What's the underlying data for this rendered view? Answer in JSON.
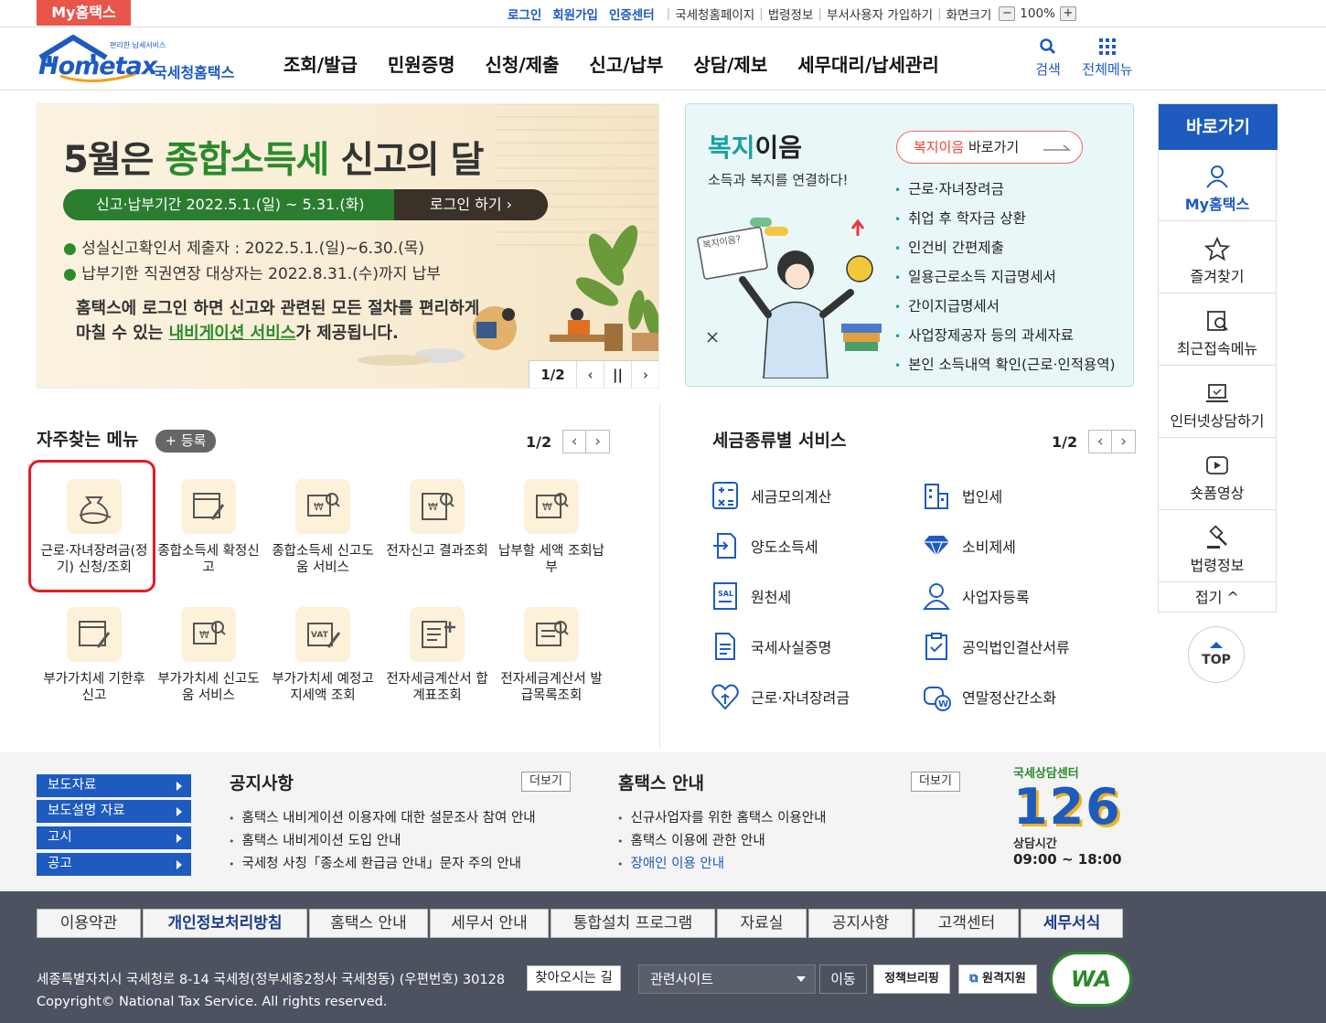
{
  "util": {
    "my_hometax": "My홈택스",
    "login": "로그인",
    "join": "회원가입",
    "cert": "인증센터",
    "nts_home": "국세청홈페이지",
    "law": "법령정보",
    "dept_join": "부서사용자 가입하기",
    "screen_size": "화면크기",
    "zoom_minus": "−",
    "zoom": "100%",
    "zoom_plus": "+"
  },
  "header": {
    "logo_top": "편리한 납세서비스",
    "logo_main": "Hometax",
    "logo_sub": "국세청홈택스",
    "gnb": [
      "조회/발급",
      "민원증명",
      "신청/제출",
      "신고/납부",
      "상담/제보",
      "세무대리/납세관리"
    ],
    "search": "검색",
    "all_menu": "전체메뉴"
  },
  "banner": {
    "title_a": "5월은 ",
    "title_b": "종합소득세",
    "title_c": " 신고의 달",
    "period": "신고·납부기간  2022.5.1.(일) ~ 5.31.(화)",
    "login_btn": "로그인 하기  ›",
    "bullet1": "성실신고확인서 제출자 : 2022.5.1.(일)~6.30.(목)",
    "bullet2": "납부기한 직권연장 대상자는 2022.8.31.(수)까지 납부",
    "desc1": "홈택스에 로그인 하면 신고와 관련된 모든 절차를 편리하게",
    "desc2a": "마칠 수 있는 ",
    "desc2b": "내비게이션 서비스",
    "desc2c": "가 제공됩니다.",
    "page": "1/2",
    "prev": "‹",
    "pause": "||",
    "next": "›"
  },
  "welfare": {
    "title_a": "복지",
    "title_b": "이음",
    "sub": "소득과 복지를 연결하다!",
    "go_a": "복지이음",
    "go_b": " 바로가기",
    "bubble": "복지이음?",
    "items": [
      "근로·자녀장려금",
      "취업 후 학자금 상환",
      "인건비 간편제출",
      "일용근로소득 지급명세서",
      "간이지급명세서",
      "사업장제공자 등의 과세자료",
      "본인 소득내역 확인(근로·인적용역)"
    ]
  },
  "quick": {
    "head": "바로가기",
    "items": [
      "My홈택스",
      "즐겨찾기",
      "최근접속메뉴",
      "인터넷상담하기",
      "숏폼영상",
      "법령정보"
    ],
    "fold": "접기 ^",
    "top": "TOP"
  },
  "freq": {
    "title": "자주찾는 메뉴",
    "register": "+ 등록",
    "page": "1/2",
    "prev": "‹",
    "next": "›",
    "items": [
      "근로·자녀장려금(정기) 신청/조회",
      "종합소득세 확정신고",
      "종합소득세 신고도움 서비스",
      "전자신고 결과조회",
      "납부할 세액 조회납부",
      "부가가치세 기한후 신고",
      "부가가치세 신고도움 서비스",
      "부가가치세 예정고지세액 조회",
      "전자세금계산서 합계표조회",
      "전자세금계산서 발급목록조회"
    ]
  },
  "tax": {
    "title": "세금종류별 서비스",
    "page": "1/2",
    "prev": "‹",
    "next": "›",
    "items": [
      "세금모의계산",
      "법인세",
      "양도소득세",
      "소비제세",
      "원천세",
      "사업자등록",
      "국세사실증명",
      "공익법인결산서류",
      "근로·자녀장려금",
      "연말정산간소화"
    ]
  },
  "notice": {
    "side_buttons": [
      "보도자료",
      "보도설명 자료",
      "고시",
      "공고"
    ],
    "notice_title": "공지사항",
    "more": "더보기",
    "notice_items": [
      "홈택스 내비게이션 이용자에 대한 설문조사 참여 안내",
      "홈택스 내비게이션 도입 안내",
      "국세청 사칭「종소세 환급금 안내」문자 주의 안내"
    ],
    "guide_title": "홈택스 안내",
    "guide_items": [
      "신규사업자를 위한 홈택스 이용안내",
      "홈택스 이용에 관한 안내",
      "장애인 이용 안내"
    ],
    "center_label": "국세상담센터",
    "center_num": "126",
    "hours_label": "상담시간",
    "hours": "09:00 ~ 18:00"
  },
  "footer": {
    "links": [
      "이용약관",
      "개인정보처리방침",
      "홈택스 안내",
      "세무서 안내",
      "통합설치 프로그램",
      "자료실",
      "공지사항",
      "고객센터",
      "세무서식"
    ],
    "address": "세종특별자치시 국세청로 8-14 국세청(정부세종2청사 국세청동) (우편번호) 30128",
    "find": "찾아오시는 길",
    "copyright": "Copyright© National Tax Service. All rights reserved.",
    "related": "관련사이트",
    "go": "이동",
    "briefing": "정책브리핑",
    "remote": "원격지원",
    "wa": "WA"
  },
  "colors": {
    "accent": "#1e5bbf",
    "brand_green": "#2a8a2c",
    "highlight": "#e31b23",
    "footer_bg": "#4d5260"
  }
}
